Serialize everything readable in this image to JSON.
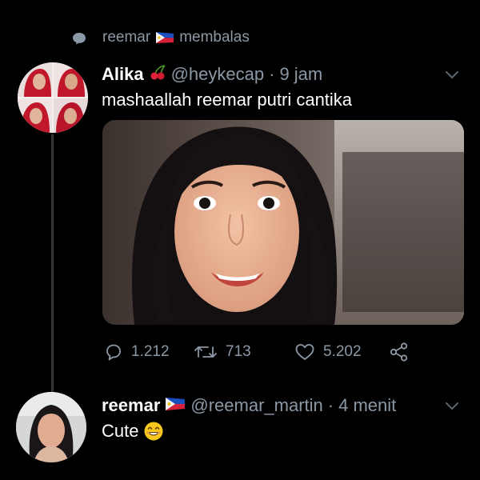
{
  "context": {
    "name": "reemar",
    "action": "membalas"
  },
  "tweet1": {
    "display_name": "Alika",
    "handle": "@heykecap",
    "separator": "·",
    "time": "9 jam",
    "text": "mashaallah reemar putri cantika",
    "stats": {
      "replies": "1.212",
      "retweets": "713",
      "likes": "5.202"
    }
  },
  "tweet2": {
    "display_name": "reemar",
    "handle": "@reemar_martin",
    "separator": "·",
    "time": "4 menit",
    "text": "Cute"
  },
  "icons": {
    "context": "speech-bubble-icon",
    "reply": "reply-icon",
    "retweet": "retweet-icon",
    "like": "heart-icon",
    "share": "share-icon",
    "more": "chevron-down-icon",
    "badge1": "cherries-emoji",
    "badge2": "philippines-flag-emoji",
    "emoji": "smiling-face-emoji"
  },
  "colors": {
    "background": "#000000",
    "text": "#ffffff",
    "muted": "#8b98a5",
    "thread_line": "#333639"
  }
}
